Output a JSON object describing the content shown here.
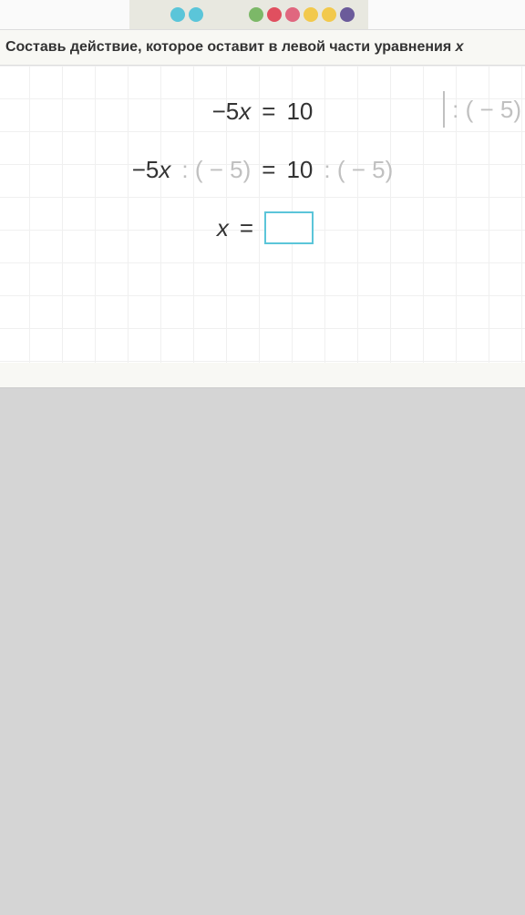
{
  "instruction": {
    "text_prefix": "Составь действие, которое оставит в левой части уравнения ",
    "variable": "x"
  },
  "equation": {
    "line1_left": "−5",
    "line1_var": "x",
    "line1_eq": " = ",
    "line1_right": "10",
    "operation": ": ( − 5)",
    "line2_left": "−5",
    "line2_var": "x",
    "line2_op_left": " : ( − 5)",
    "line2_eq": " = ",
    "line2_right": "10",
    "line2_op_right": " : ( − 5)",
    "line3_var": "x",
    "line3_eq": " = ",
    "answer": ""
  }
}
